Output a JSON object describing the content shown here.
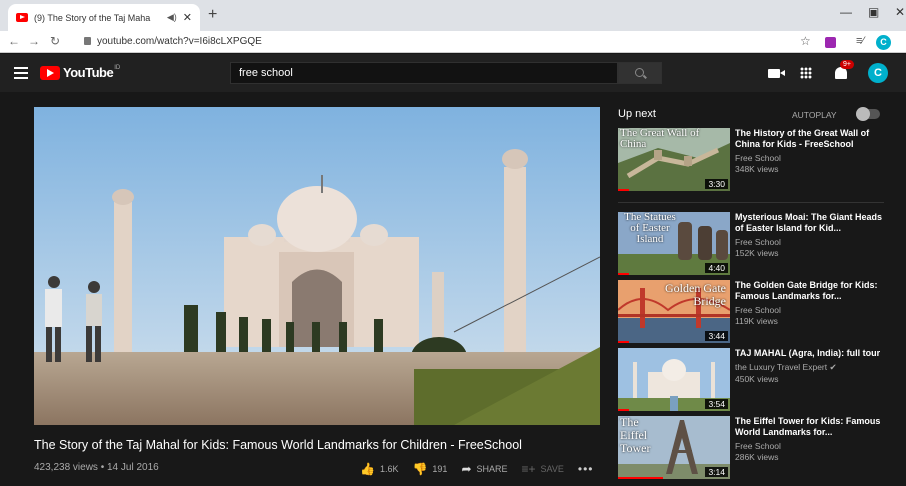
{
  "browser": {
    "tab_title": "(9) The Story of the Taj Maha",
    "tab_audio_icon": "speaker-icon",
    "new_tab": "+",
    "url": "youtube.com/watch?v=I6i8cLXPGQE",
    "profile_letter": "C"
  },
  "youtube": {
    "logo_text": "YouTube",
    "logo_region": "ID",
    "search_query": "free school",
    "notification_count": "9+",
    "avatar_letter": "C"
  },
  "video": {
    "title": "The Story of the Taj Mahal for Kids: Famous World Landmarks for Children - FreeSchool",
    "meta": "423,238 views • 14 Jul 2016",
    "likes": "1.6K",
    "dislikes": "191",
    "share_label": "SHARE",
    "save_label": "SAVE",
    "more_label": "•••"
  },
  "upnext": {
    "heading": "Up next",
    "autoplay_label": "AUTOPLAY",
    "autoplay_on": false,
    "items": [
      {
        "title": "The History of the Great Wall of China for Kids - FreeSchool",
        "channel": "Free School",
        "views": "348K views",
        "duration": "3:30",
        "overlay_left": "The Great Wall of China",
        "overlay_right": "",
        "progress": 0.1
      },
      {
        "title": "Mysterious Moai: The Giant Heads of Easter Island for Kid...",
        "channel": "Free School",
        "views": "152K views",
        "duration": "4:40",
        "overlay_left": "The Statues of Easter Island",
        "overlay_right": "",
        "progress": 0.1
      },
      {
        "title": "The Golden Gate Bridge for Kids: Famous Landmarks for...",
        "channel": "Free School",
        "views": "119K views",
        "duration": "3:44",
        "overlay_left": "",
        "overlay_right": "Golden Gate Bridge",
        "progress": 0.1
      },
      {
        "title": "TAJ MAHAL (Agra, India): full tour",
        "channel": "the Luxury Travel Expert ✔",
        "views": "450K views",
        "duration": "3:54",
        "overlay_left": "",
        "overlay_right": "",
        "progress": 0.1
      },
      {
        "title": "The Eiffel Tower for Kids: Famous World Landmarks for...",
        "channel": "Free School",
        "views": "286K views",
        "duration": "3:14",
        "overlay_left": "The Eiffel Tower",
        "overlay_right": "",
        "progress": 0.4
      }
    ]
  },
  "colors": {
    "page_bg": "#181818",
    "header_bg": "#212121",
    "accent_red": "#ff0000",
    "avatar": "#00b0cc"
  }
}
